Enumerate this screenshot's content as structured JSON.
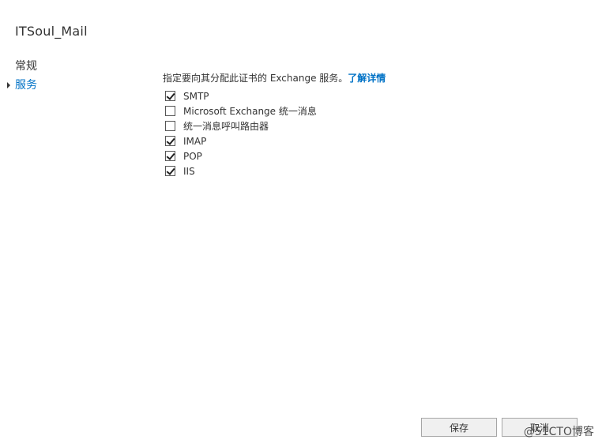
{
  "window": {
    "title": "ITSoul_Mail"
  },
  "nav": {
    "items": [
      {
        "label": "常规",
        "selected": false
      },
      {
        "label": "服务",
        "selected": true
      }
    ]
  },
  "content": {
    "description": "指定要向其分配此证书的 Exchange 服务。",
    "learn_more": "了解详情",
    "services": [
      {
        "label": "SMTP",
        "checked": true
      },
      {
        "label": "Microsoft Exchange 统一消息",
        "checked": false
      },
      {
        "label": "统一消息呼叫路由器",
        "checked": false
      },
      {
        "label": "IMAP",
        "checked": true
      },
      {
        "label": "POP",
        "checked": true
      },
      {
        "label": "IIS",
        "checked": true
      }
    ]
  },
  "footer": {
    "save_label": "保存",
    "cancel_label": "取消"
  },
  "watermark": "@51CTO博客",
  "colors": {
    "accent": "#0072c6",
    "text": "#333333",
    "button_bg": "#f0f0f0",
    "button_border": "#a6a6a6"
  }
}
